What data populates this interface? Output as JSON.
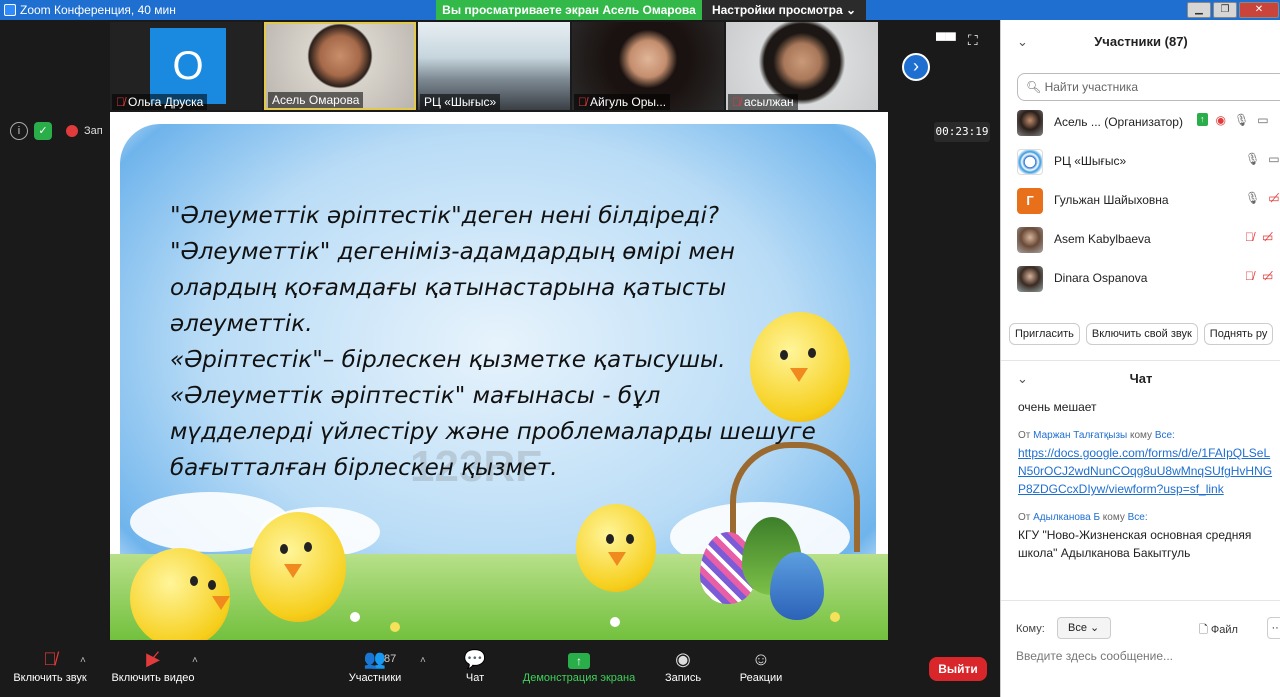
{
  "window": {
    "title": "Zoom Конференция, 40 мин",
    "share_banner": "Вы просматриваете экран Асель Омарова",
    "view_settings": "Настройки просмотра ⌄"
  },
  "thumbnails": [
    {
      "name": "Ольга Друска",
      "initial": "О",
      "muted": true
    },
    {
      "name": "Асель Омарова",
      "muted": false
    },
    {
      "name": "РЦ «Шығыс»",
      "muted": false
    },
    {
      "name": "Айгуль Оры...",
      "muted": true
    },
    {
      "name": "асылжан",
      "muted": true
    }
  ],
  "meeting_info": {
    "record_label": "Зап",
    "timer": "00:23:19"
  },
  "slide": {
    "lines": [
      "\"Әлеуметтік әріптестік\"деген  нені білдіреді?",
      "\"Әлеуметтік\" дегеніміз-адамдардың өмірі мен",
      "олардың қоғамдағы қатынастарына қатысты",
      "әлеуметтік.",
      "«Әріптестік\"– бірлескен қызметке қатысушы.",
      "«Әлеуметтік әріптестік\" мағынасы - бұл",
      "мүдделерді үйлестіру және проблемаларды шешуге",
      "бағытталған бірлескен қызмет."
    ],
    "watermark": "123RF"
  },
  "toolbar": {
    "unmute": "Включить звук",
    "video": "Включить видео",
    "participants": "Участники",
    "participants_count": "87",
    "chat": "Чат",
    "share": "Демонстрация экрана",
    "record": "Запись",
    "reactions": "Реакции",
    "leave": "Выйти"
  },
  "participants_panel": {
    "title": "Участники (87)",
    "search_placeholder": "Найти участника",
    "list": [
      {
        "name": "Асель ...  (Организатор)",
        "avatar": "photo"
      },
      {
        "name": "РЦ «Шығыс»",
        "avatar": "logo"
      },
      {
        "name": "Гульжан Шайыховна",
        "avatar": "letter",
        "letter": "Г"
      },
      {
        "name": "Asem Kabylbaeva",
        "avatar": "photo"
      },
      {
        "name": "Dinara Ospanova",
        "avatar": "photo"
      }
    ],
    "invite": "Пригласить",
    "unmute_me": "Включить свой звук",
    "raise_hand": "Поднять ру"
  },
  "chat": {
    "title": "Чат",
    "messages": [
      {
        "text": "очень мешает"
      },
      {
        "meta_from": "От",
        "sender": "Маржан Талғатқызы",
        "meta_to": "кому",
        "recipient": "Все:",
        "link": "https://docs.google.com/forms/d/e/1FAIpQLSeLN50rOCJ2wdNunCOqg8uU8wMnqSUfgHvHNGP8ZDGCcxDIyw/viewform?usp=sf_link"
      },
      {
        "meta_from": "От",
        "sender": "Адылканова Б",
        "meta_to": "кому",
        "recipient": "Все:",
        "text": "КГУ \"Ново-Жизненская основная средняя школа\" Адылканова Бакытгуль"
      }
    ],
    "to_label": "Кому:",
    "to_value": "Все",
    "file": "Файл",
    "more": "···",
    "input_placeholder": "Введите здесь сообщение..."
  },
  "colors": {
    "accent": "#1f6fd1",
    "green": "#32b949",
    "leave": "#d9262b"
  }
}
